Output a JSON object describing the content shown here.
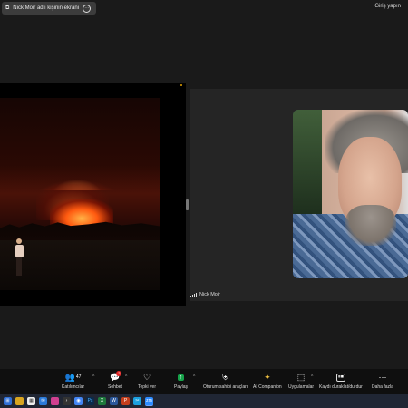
{
  "top": {
    "share_label": "Nick Moir adlı kişinin ekranı",
    "login_label": "Giriş yapın"
  },
  "participant": {
    "name": "Nick Moir"
  },
  "toolbar": {
    "participants_count": "47",
    "participants_label": "Katılımcılar",
    "chat_label": "Sohbet",
    "chat_badge": "2",
    "react_label": "Tepki ver",
    "share_label": "Paylaş",
    "host_tools_label": "Oturum sahibi araçları",
    "ai_label": "AI Companion",
    "apps_label": "Uygulamalar",
    "record_label": "Kaydı duraklat/durdur",
    "more_label": "Daha fazla"
  },
  "taskbar": {
    "apps": [
      "windows-start",
      "file-explorer",
      "calendar",
      "mail",
      "media",
      "terminal",
      "chrome",
      "photoshop",
      "excel",
      "word",
      "powerpoint",
      "snipping",
      "zoom"
    ],
    "zoom_label": "zm",
    "ps_label": "Ps"
  },
  "colors": {
    "share_green": "#16a34a",
    "badge_red": "#e02828",
    "status_dot": "#e2a000"
  }
}
